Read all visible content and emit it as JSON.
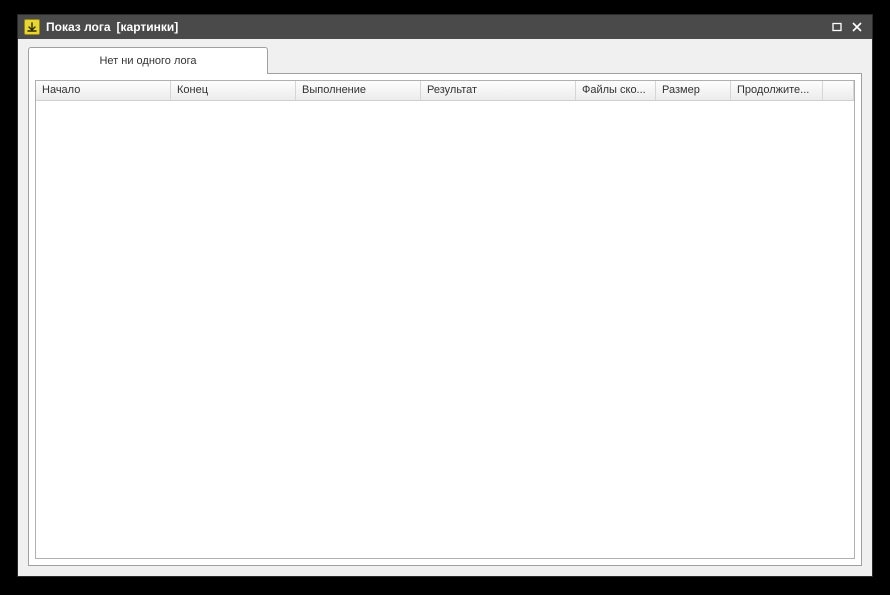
{
  "window": {
    "title": "Показ лога",
    "context": "[картинки]"
  },
  "tabs": [
    {
      "label": "Нет ни одного лога"
    }
  ],
  "table": {
    "columns": [
      "Начало",
      "Конец",
      "Выполнение",
      "Результат",
      "Файлы ско...",
      "Размер",
      "Продолжите...",
      ""
    ],
    "rows": []
  }
}
